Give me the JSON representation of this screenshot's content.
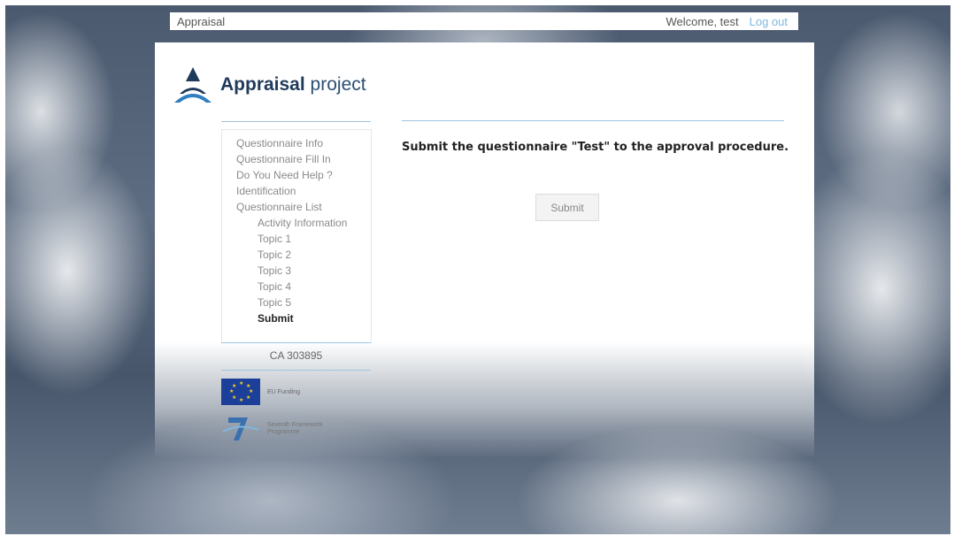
{
  "topbar": {
    "app_title": "Appraisal",
    "welcome": "Welcome, test",
    "logout": "Log out"
  },
  "logo": {
    "bold": "Appraisal",
    "light": "project"
  },
  "nav": {
    "items": [
      "Questionnaire Info",
      "Questionnaire Fill In",
      "Do You Need Help ?",
      "Identification",
      "Questionnaire List",
      "Activity Information",
      "Topic 1",
      "Topic 2",
      "Topic 3",
      "Topic 4",
      "Topic 5",
      "Submit"
    ]
  },
  "grant": "CA 303895",
  "eu": {
    "label": "EU Funding"
  },
  "fp7": {
    "label": "Seventh Framework Programme"
  },
  "main": {
    "heading": "Submit the questionnaire \"Test\" to the approval procedure.",
    "submit_label": "Submit"
  },
  "colors": {
    "accent": "#7fb7dd",
    "divider": "#9ec5e2",
    "brand": "#1f3a5a"
  }
}
